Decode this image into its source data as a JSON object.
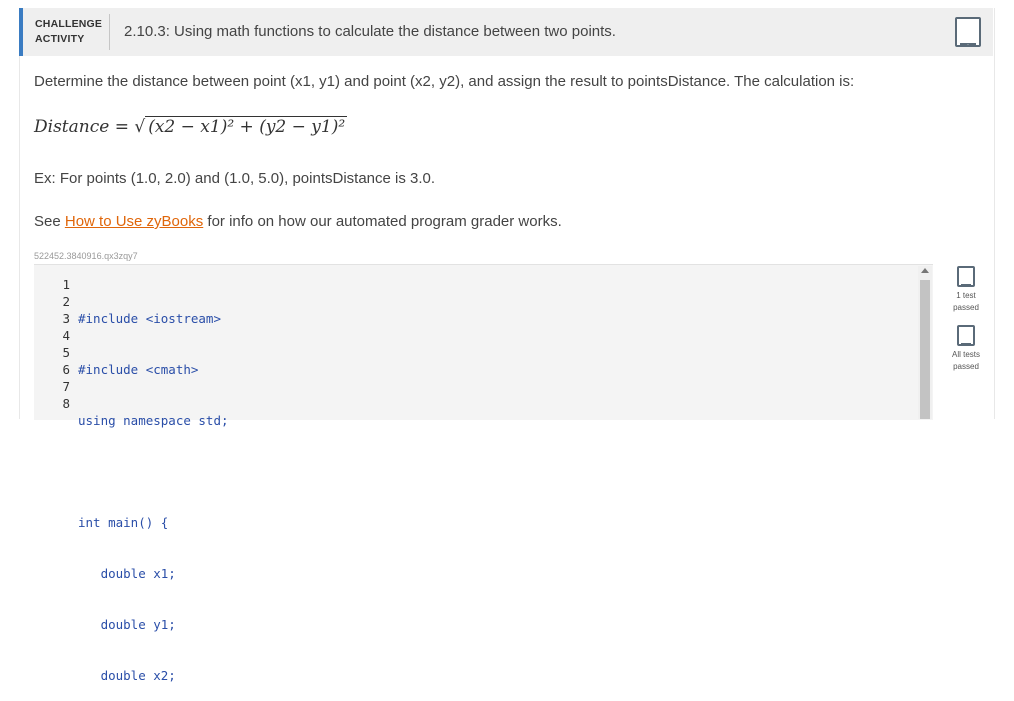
{
  "header": {
    "tag_line1": "CHALLENGE",
    "tag_line2": "ACTIVITY",
    "title": "2.10.3: Using math functions to calculate the distance between two points."
  },
  "description": "Determine the distance between point (x1, y1) and point (x2, y2), and assign the result to pointsDistance. The calculation is:",
  "formula": {
    "lhs": "Distance",
    "eq": "=",
    "radicand": "(x2 − x1)² + (y2 − y1)²"
  },
  "example": "Ex: For points (1.0, 2.0) and (1.0, 5.0), pointsDistance is 3.0.",
  "see": {
    "prefix": "See ",
    "link": "How to Use zyBooks",
    "suffix": " for info on how our automated program grader works."
  },
  "activity_id": "522452.3840916.qx3zqy7",
  "code": {
    "line_numbers": [
      "1",
      "2",
      "3",
      "4",
      "5",
      "6",
      "7",
      "8"
    ],
    "lines": [
      "#include <iostream>",
      "#include <cmath>",
      "using namespace std;",
      "",
      "int main() {",
      "   double x1;",
      "   double y1;",
      "   double x2;"
    ]
  },
  "status": {
    "test1": [
      "1 test",
      "passed"
    ],
    "all": [
      "All tests",
      "passed"
    ]
  },
  "colors": {
    "accent": "#3a7cc2",
    "link": "#e0660a",
    "code": "#2a4ea8"
  }
}
